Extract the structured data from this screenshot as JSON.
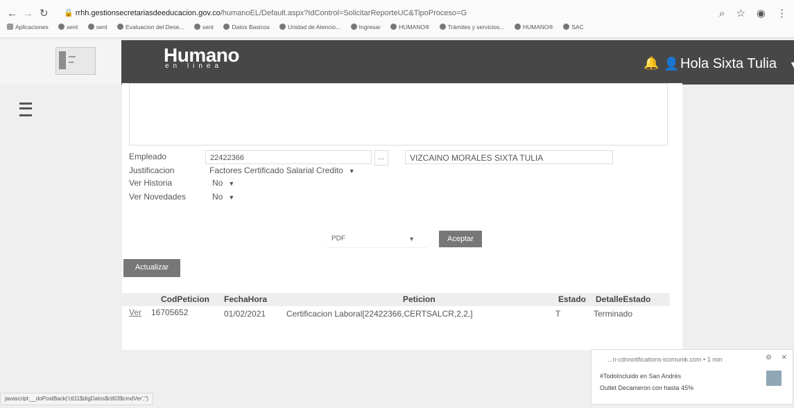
{
  "browser": {
    "url_host": "rrhh.gestionsecretariasdeeducacion.gov.co",
    "url_path": "/humanoEL/Default.aspx?IdControl=SolicitarReporteUC&TipoProceso=G",
    "bookmarks": [
      "Aplicaciones",
      "sent",
      "sent",
      "Evaluacion del Dese...",
      "sent",
      "Datos Basicos",
      "Unidad de Atencio...",
      "Ingresar",
      "HUMANO®",
      "Trámites y servicios...",
      "HUMANO®",
      "SAC"
    ],
    "status_url": "javascript:__doPostBack('ctl11$dtgDatos$ctl03$cmdVer','')"
  },
  "header": {
    "brand": "Humano",
    "brand_sub": "en linea",
    "greeting": "Hola Sixta Tulia"
  },
  "form": {
    "empleado_label": "Empleado",
    "empleado_value": "22422366",
    "lookup_button": "...",
    "empleado_name": "VIZCAINO MORALES SIXTA TULIA",
    "justificacion_label": "Justificacion",
    "justificacion_value": "Factores Certificado Salarial Credito",
    "ver_historia_label": "Ver Historia",
    "ver_historia_value": "No",
    "ver_novedades_label": "Ver Novedades",
    "ver_novedades_value": "No",
    "format_value": "PDF",
    "aceptar_button": "Aceptar",
    "actualizar_button": "Actualizar"
  },
  "table": {
    "columns": [
      "CodPeticion",
      "FechaHora",
      "Peticion",
      "Estado",
      "DetalleEstado"
    ],
    "rows": [
      {
        "action": "Ver",
        "cod": "16705652",
        "fecha": "01/02/2021",
        "peticion": "Certificacion Laboral[22422366,CERTSALCR,2,2,]",
        "estado": "T",
        "detalle": "Terminado"
      }
    ]
  },
  "notification": {
    "source": "...n-cdnnotifications-icomunik.com • 1 min",
    "line1": "#TodoIncluido en San Andrés",
    "line2": "Outlet Decameron con hasta 45%"
  }
}
